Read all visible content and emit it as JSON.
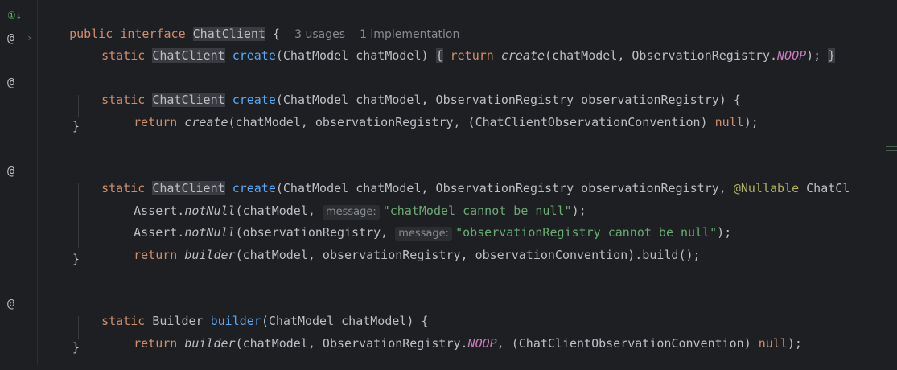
{
  "gutter": {
    "line1_icon": "①↓",
    "at_symbol": "@",
    "chevron": "›"
  },
  "header": {
    "kw_public": "public",
    "kw_interface": "interface",
    "name": "ChatClient",
    "brace": " {",
    "usages": "3 usages",
    "impls": "1 implementation"
  },
  "l2": {
    "static": "static",
    "type": "ChatClient",
    "fn": "create",
    "params": "(ChatModel chatModel)",
    "ob": "{",
    "ret": "return",
    "call": "create",
    "args": "(chatModel, ObservationRegistry.",
    "noop": "NOOP",
    "end": ");",
    "cb": "}"
  },
  "l3": {
    "static": "static",
    "type": "ChatClient",
    "fn": "create",
    "params": "(ChatModel chatModel, ObservationRegistry observationRegistry) {"
  },
  "l4": {
    "ret": "return",
    "call": "create",
    "args": "(chatModel, observationRegistry, (ChatClientObservationConvention) ",
    "null": "null",
    "end": ");"
  },
  "l5": {
    "cb": "}"
  },
  "l6": {
    "static": "static",
    "type": "ChatClient",
    "fn": "create",
    "params": "(ChatModel chatModel, ObservationRegistry observationRegistry, ",
    "ann": "@Nullable",
    "rest": " ChatCl"
  },
  "l7": {
    "cls": "Assert.",
    "fn": "notNull",
    "args": "(chatModel, ",
    "hint": "message:",
    "str": "\"chatModel cannot be null\"",
    "end": ");"
  },
  "l8": {
    "cls": "Assert.",
    "fn": "notNull",
    "args": "(observationRegistry, ",
    "hint": "message:",
    "str": "\"observationRegistry cannot be null\"",
    "end": ");"
  },
  "l9": {
    "ret": "return",
    "call": "builder",
    "args": "(chatModel, observationRegistry, observationConvention).build();"
  },
  "l10": {
    "cb": "}"
  },
  "l11": {
    "static": "static",
    "type": "Builder",
    "fn": "builder",
    "params": "(ChatModel chatModel) {"
  },
  "l12": {
    "ret": "return",
    "call": "builder",
    "args": "(chatModel, ObservationRegistry.",
    "noop": "NOOP",
    "args2": ", (ChatClientObservationConvention) ",
    "null": "null",
    "end": ");"
  },
  "l13": {
    "cb": "}"
  }
}
